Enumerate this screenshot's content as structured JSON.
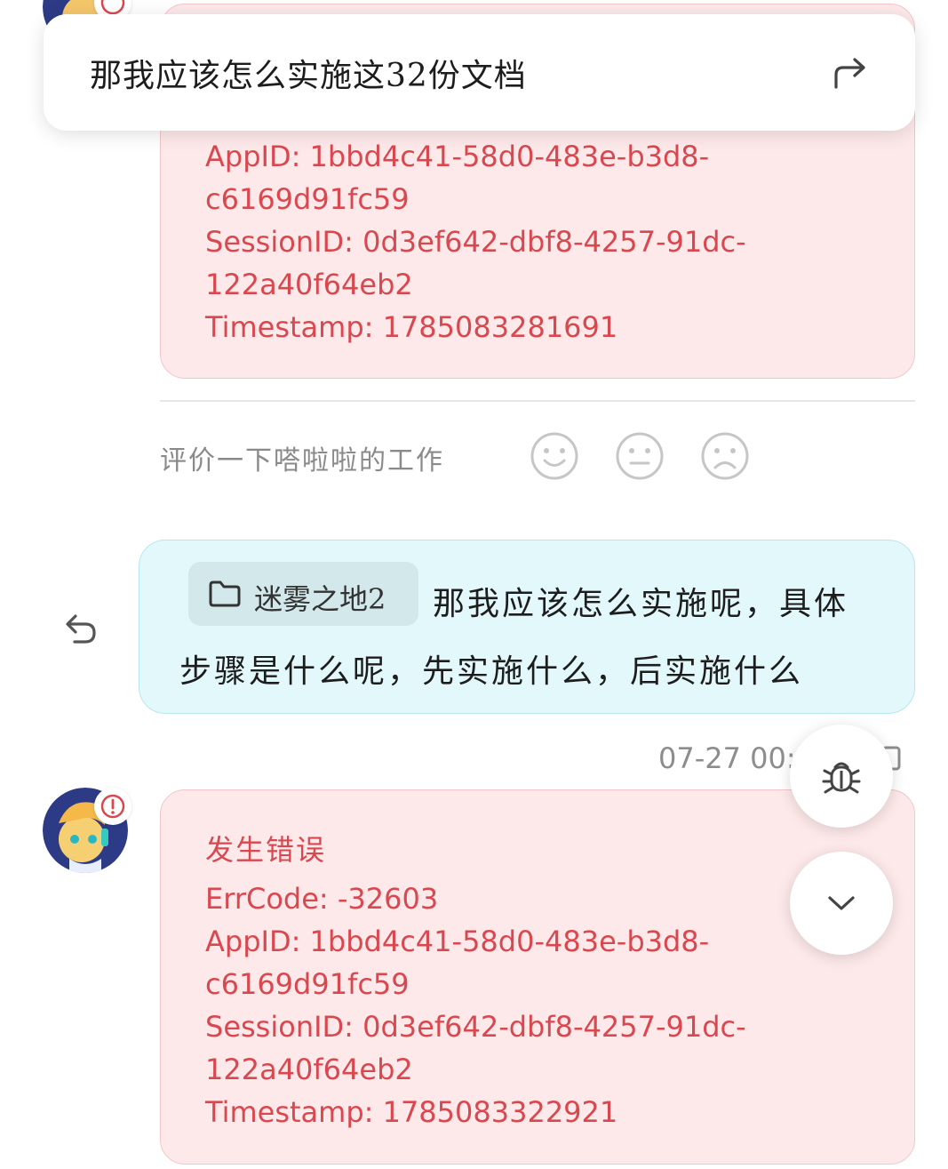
{
  "question_bar": {
    "text": "那我应该怎么实施这32份文档"
  },
  "error_card_top": {
    "lines": [
      "AppID: 1bbd4c41-58d0-483e-b3d8-",
      "c6169d91fc59",
      "SessionID: 0d3ef642-dbf8-4257-91dc-",
      "122a40f64eb2",
      "Timestamp: 1785083281691"
    ]
  },
  "rating": {
    "label": "评价一下嗒啦啦的工作",
    "options": [
      "smile-face-icon",
      "neutral-face-icon",
      "sad-face-icon"
    ]
  },
  "user_message": {
    "folder_tag": "迷雾之地2",
    "line1": "那我应该怎么实施呢，具体",
    "line2": "步骤是什么呢，先实施什么，后实施什么"
  },
  "timestamp": {
    "text": "07-27 00:"
  },
  "error_card_bottom": {
    "title": "发生错误",
    "lines": [
      "ErrCode: -32603",
      "AppID: 1bbd4c41-58d0-483e-b3d8-",
      "c6169d91fc59",
      "SessionID: 0d3ef642-dbf8-4257-91dc-",
      "122a40f64eb2",
      "Timestamp: 1785083322921"
    ]
  },
  "colors": {
    "error_text": "#d9474f",
    "error_bg": "#fde9ea",
    "user_bubble_bg": "#e3f8fb",
    "folder_tag_bg": "#d3e8ea"
  }
}
